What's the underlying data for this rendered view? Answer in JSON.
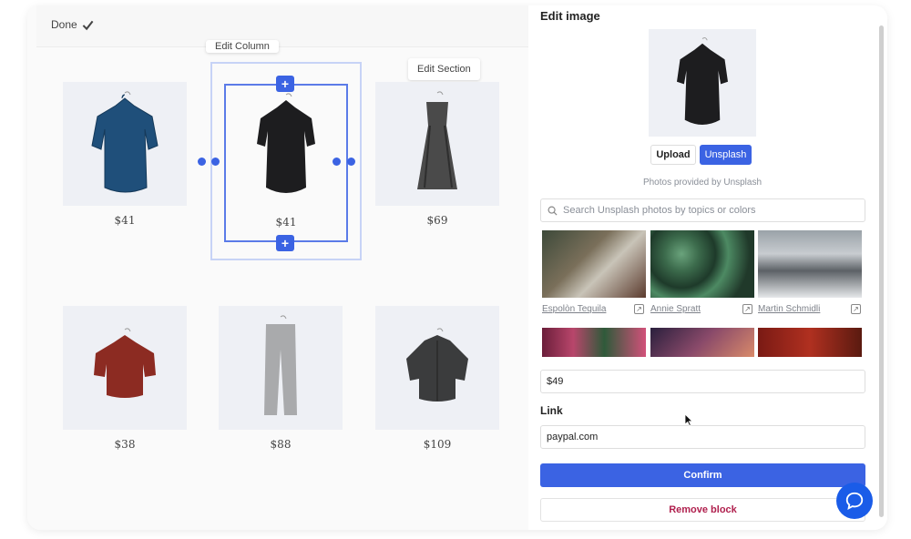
{
  "toolbar": {
    "done_label": "Done"
  },
  "canvas": {
    "edit_column_label": "Edit Column",
    "edit_section_label": "Edit Section",
    "products": [
      {
        "price": "$41",
        "color": "#1f4f7a"
      },
      {
        "price": "$41",
        "color": "#1d1d1f"
      },
      {
        "price": "$69",
        "color": "#4a4a4a"
      },
      {
        "price": "$38",
        "color": "#8c2b22"
      },
      {
        "price": "$88",
        "color": "#a9aaac"
      },
      {
        "price": "$109",
        "color": "#3b3c3d"
      }
    ]
  },
  "panel": {
    "title": "Edit image",
    "upload_label": "Upload",
    "unsplash_label": "Unsplash",
    "provided_text": "Photos provided by Unsplash",
    "search_placeholder": "Search Unsplash photos by topics or colors",
    "photos": [
      {
        "credit": "Espolòn Tequila"
      },
      {
        "credit": "Annie Spratt"
      },
      {
        "credit": "Martin Schmidli"
      }
    ],
    "price_value": "$49",
    "link_label": "Link",
    "link_value": "paypal.com",
    "confirm_label": "Confirm",
    "remove_label": "Remove block"
  },
  "colors": {
    "accent": "#3b63e3",
    "danger": "#b0204e"
  }
}
